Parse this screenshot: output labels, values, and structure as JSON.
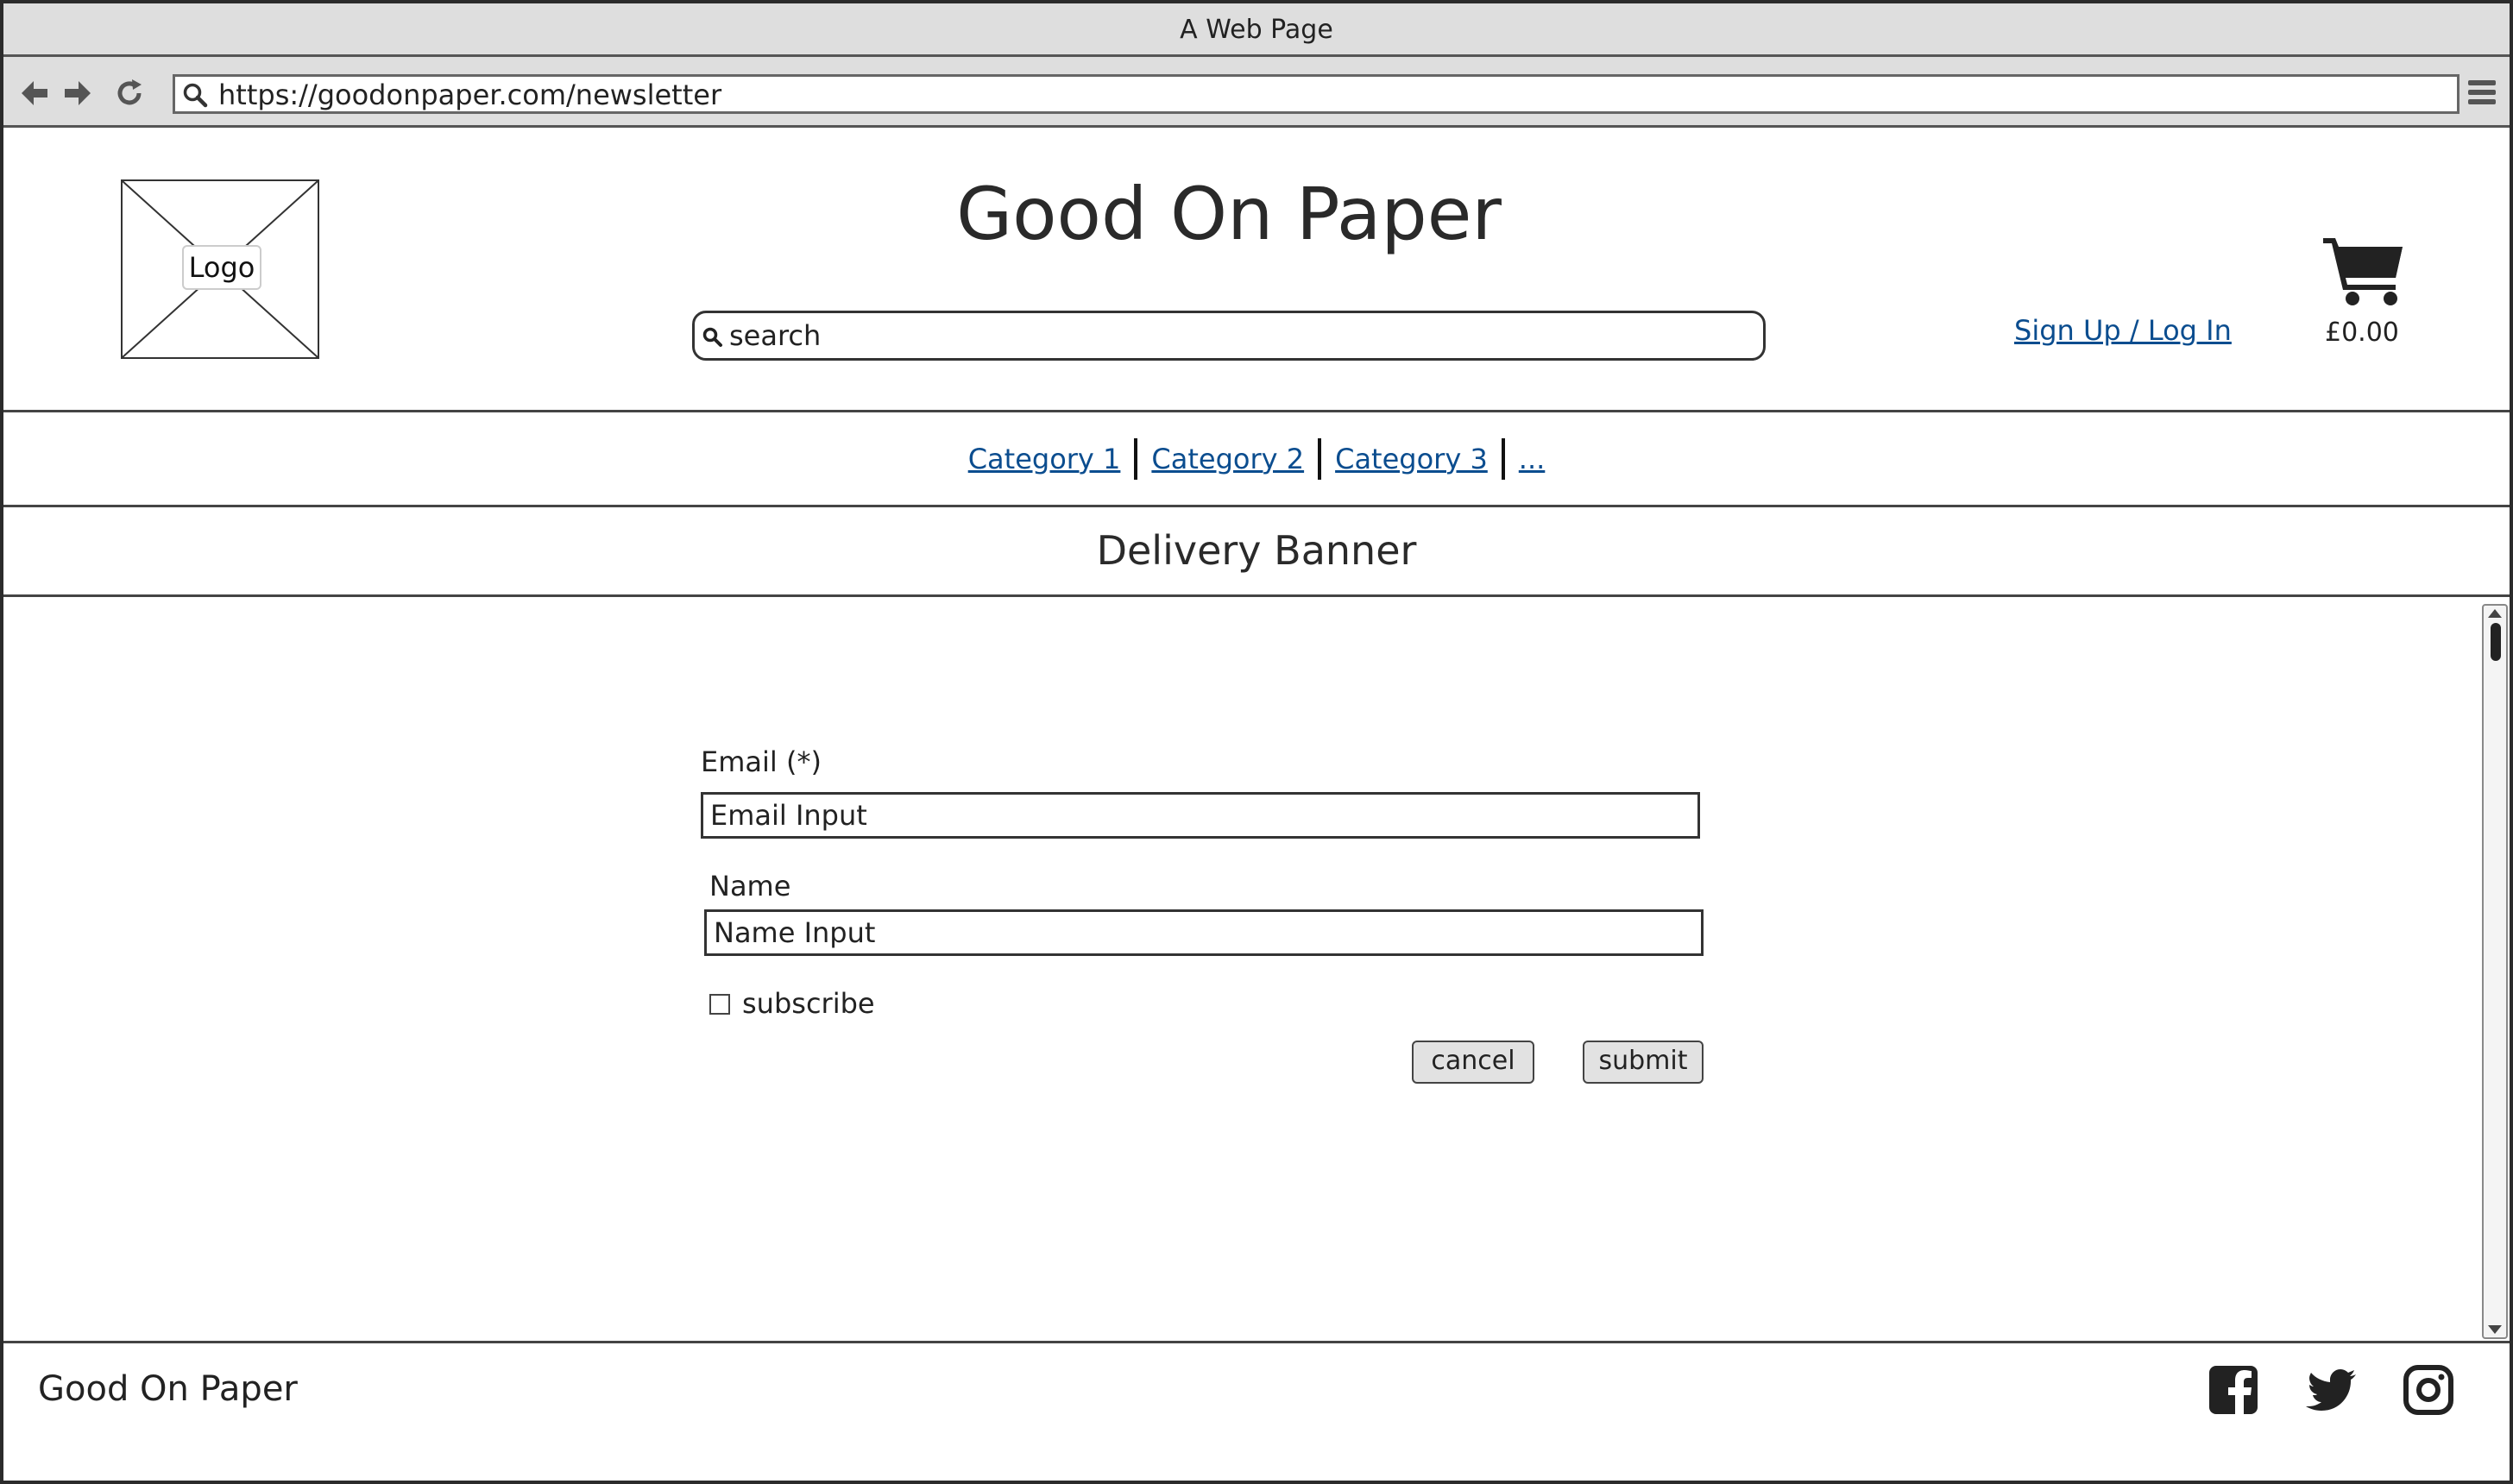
{
  "window": {
    "title": "A Web Page"
  },
  "browser": {
    "url": "https://goodonpaper.com/newsletter"
  },
  "header": {
    "logo_label": "Logo",
    "site_title": "Good On Paper",
    "search_value": "search",
    "signup_label": "Sign Up / Log In",
    "cart_total": "£0.00"
  },
  "categories": {
    "items": [
      {
        "label": "Category 1"
      },
      {
        "label": "Category 2"
      },
      {
        "label": "Category 3"
      },
      {
        "label": "..."
      }
    ]
  },
  "banner": {
    "text": "Delivery Banner"
  },
  "form": {
    "email_label": "Email (*)",
    "email_value": "Email Input",
    "name_label": "Name",
    "name_value": "Name Input",
    "subscribe_label": "subscribe",
    "subscribe_checked": false,
    "cancel_label": "cancel",
    "submit_label": "submit"
  },
  "footer": {
    "brand": "Good On Paper",
    "social_icons": [
      "facebook-icon",
      "twitter-icon",
      "instagram-icon"
    ]
  },
  "colors": {
    "link": "#0b4d8f",
    "chrome": "#dedede",
    "text": "#222222"
  }
}
